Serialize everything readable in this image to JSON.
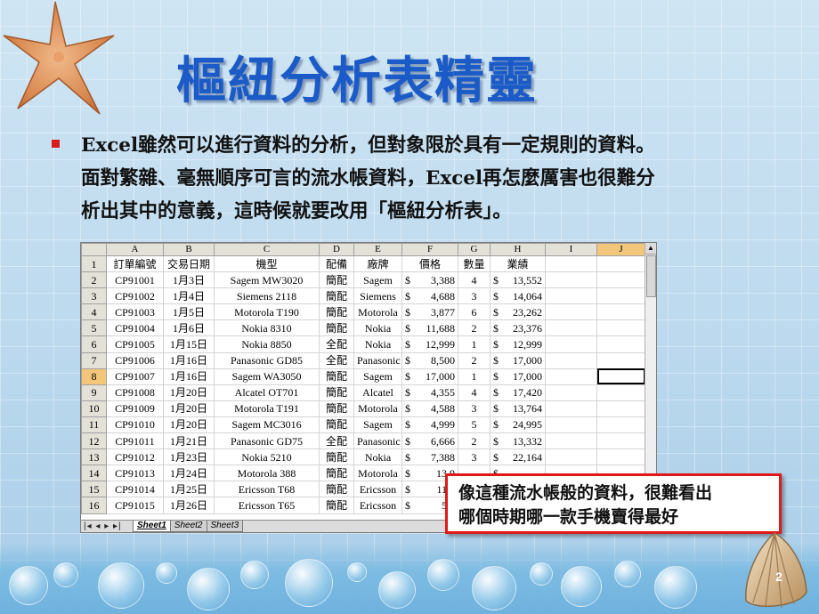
{
  "slide": {
    "title": "樞紐分析表精靈",
    "bullet_lines": [
      "Excel雖然可以進行資料的分析，但對象限於具有一定規則的資料。",
      "面對繁雜、毫無順序可言的流水帳資料，Excel再怎麼厲害也很難分",
      "析出其中的意義，這時候就要改用「樞紐分析表」。"
    ],
    "callout_lines": [
      "像這種流水帳般的資料，很難看出",
      "哪個時期哪一款手機賣得最好"
    ],
    "page_number": "2"
  },
  "colors": {
    "title": "#1a5bc8",
    "bullet": "#d81b1b",
    "callout_border": "#e01818",
    "selection_highlight": "#f3c77a"
  },
  "spreadsheet": {
    "column_letters": [
      "A",
      "B",
      "C",
      "D",
      "E",
      "F",
      "G",
      "H",
      "I",
      "J"
    ],
    "headers": [
      "訂單編號",
      "交易日期",
      "機型",
      "配備",
      "廠牌",
      "價格",
      "數量",
      "業績"
    ],
    "rows": [
      [
        "CP91001",
        "1月3日",
        "Sagem MW3020",
        "簡配",
        "Sagem",
        "3,388",
        "4",
        "13,552"
      ],
      [
        "CP91002",
        "1月4日",
        "Siemens 2118",
        "簡配",
        "Siemens",
        "4,688",
        "3",
        "14,064"
      ],
      [
        "CP91003",
        "1月5日",
        "Motorola T190",
        "簡配",
        "Motorola",
        "3,877",
        "6",
        "23,262"
      ],
      [
        "CP91004",
        "1月6日",
        "Nokia 8310",
        "簡配",
        "Nokia",
        "11,688",
        "2",
        "23,376"
      ],
      [
        "CP91005",
        "1月15日",
        "Nokia 8850",
        "全配",
        "Nokia",
        "12,999",
        "1",
        "12,999"
      ],
      [
        "CP91006",
        "1月16日",
        "Panasonic GD85",
        "全配",
        "Panasonic",
        "8,500",
        "2",
        "17,000"
      ],
      [
        "CP91007",
        "1月16日",
        "Sagem WA3050",
        "簡配",
        "Sagem",
        "17,000",
        "1",
        "17,000"
      ],
      [
        "CP91008",
        "1月20日",
        "Alcatel OT701",
        "簡配",
        "Alcatel",
        "4,355",
        "4",
        "17,420"
      ],
      [
        "CP91009",
        "1月20日",
        "Motorola T191",
        "簡配",
        "Motorola",
        "4,588",
        "3",
        "13,764"
      ],
      [
        "CP91010",
        "1月20日",
        "Sagem MC3016",
        "簡配",
        "Sagem",
        "4,999",
        "5",
        "24,995"
      ],
      [
        "CP91011",
        "1月21日",
        "Panasonic GD75",
        "全配",
        "Panasonic",
        "6,666",
        "2",
        "13,332"
      ],
      [
        "CP91012",
        "1月23日",
        "Nokia 5210",
        "簡配",
        "Nokia",
        "7,388",
        "3",
        "22,164"
      ],
      [
        "CP91013",
        "1月24日",
        "Motorola 388",
        "簡配",
        "Motorola",
        "13,9",
        "",
        ""
      ],
      [
        "CP91014",
        "1月25日",
        "Ericsson T68",
        "簡配",
        "Ericsson",
        "11,9",
        "",
        ""
      ],
      [
        "CP91015",
        "1月26日",
        "Ericsson T65",
        "簡配",
        "Ericsson",
        "5,9",
        "",
        ""
      ]
    ],
    "currency": "$",
    "row_numbers": [
      "1",
      "2",
      "3",
      "4",
      "5",
      "6",
      "7",
      "8",
      "9",
      "10",
      "11",
      "12",
      "13",
      "14",
      "15",
      "16"
    ],
    "sheet_tabs": [
      "Sheet1",
      "Sheet2",
      "Sheet3"
    ],
    "tab_nav": "|◂ ◂ ▸ ▸|"
  }
}
